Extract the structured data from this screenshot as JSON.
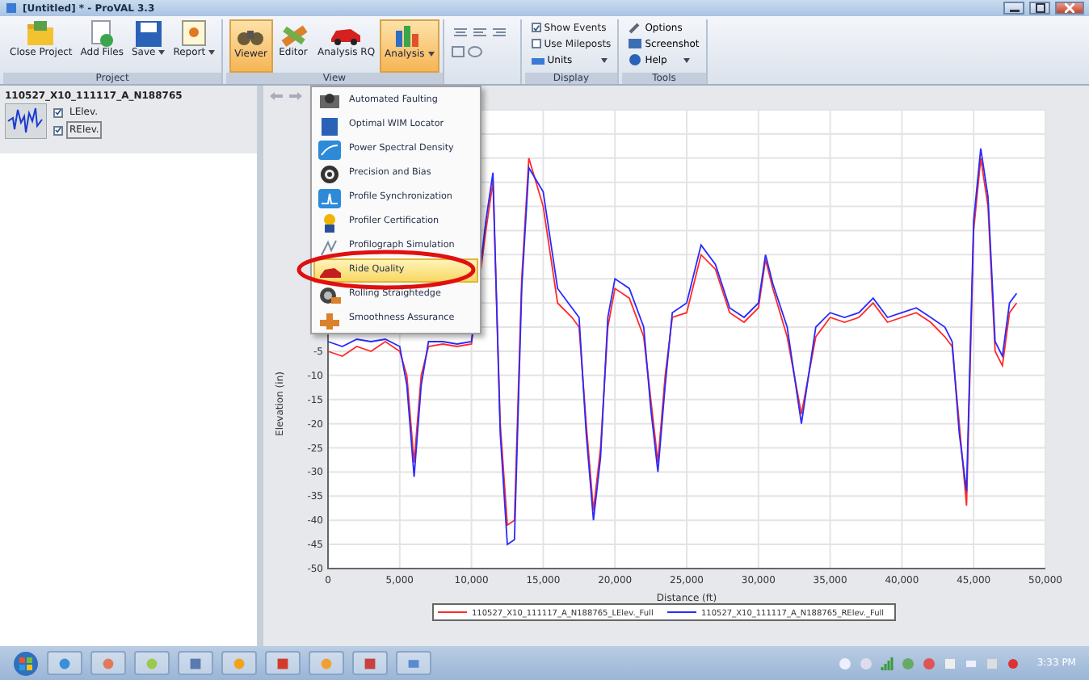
{
  "window": {
    "title": "[Untitled] * - ProVAL 3.3"
  },
  "ribbon": {
    "groups": [
      {
        "label": "Project",
        "buttons": [
          {
            "label": "Close Project",
            "dropdown": false,
            "selected": false
          },
          {
            "label": "Add Files",
            "dropdown": false,
            "selected": false
          },
          {
            "label": "Save",
            "dropdown": true,
            "selected": false
          },
          {
            "label": "Report",
            "dropdown": true,
            "selected": false
          }
        ]
      },
      {
        "label": "View",
        "buttons": [
          {
            "label": "Viewer",
            "dropdown": false,
            "selected": true
          },
          {
            "label": "Editor",
            "dropdown": false,
            "selected": false
          },
          {
            "label": "Analysis RQ",
            "dropdown": false,
            "selected": false
          },
          {
            "label": "Analysis",
            "dropdown": true,
            "selected": true
          }
        ]
      }
    ],
    "display": {
      "label": "Display",
      "items": [
        {
          "label": "Show Events",
          "kind": "check",
          "checked": true
        },
        {
          "label": "Use Mileposts",
          "kind": "check",
          "checked": false
        },
        {
          "label": "Units",
          "kind": "dropdown"
        }
      ]
    },
    "tools": {
      "label": "Tools",
      "items": [
        {
          "label": "Options",
          "dropdown": false
        },
        {
          "label": "Screenshot",
          "dropdown": false
        },
        {
          "label": "Help",
          "dropdown": true
        }
      ]
    }
  },
  "sidebar": {
    "file": "110527_X10_111117_A_N188765",
    "channels": [
      {
        "label": "LElev.",
        "checked": true
      },
      {
        "label": "RElev.",
        "checked": true
      }
    ]
  },
  "analysis_menu": [
    {
      "label": "Automated Faulting",
      "selected": false
    },
    {
      "label": "Optimal WIM Locator",
      "selected": false
    },
    {
      "label": "Power Spectral Density",
      "selected": false
    },
    {
      "label": "Precision and Bias",
      "selected": false
    },
    {
      "label": "Profile Synchronization",
      "selected": false
    },
    {
      "label": "Profiler Certification",
      "selected": false
    },
    {
      "label": "Profilograph Simulation",
      "selected": false
    },
    {
      "label": "Ride Quality",
      "selected": true
    },
    {
      "label": "Rolling Straightedge",
      "selected": false
    },
    {
      "label": "Smoothness Assurance",
      "selected": false
    }
  ],
  "chart": {
    "chart_data": {
      "type": "line",
      "xlabel": "Distance (ft)",
      "ylabel": "Elevation (in)",
      "xlim": [
        0,
        50000
      ],
      "ylim": [
        -50,
        45
      ],
      "grid": true,
      "legend": true,
      "xticks": [
        {
          "value": 0,
          "label": "0"
        },
        {
          "value": 5000,
          "label": "5,000"
        },
        {
          "value": 10000,
          "label": "10,000"
        },
        {
          "value": 15000,
          "label": "15,000"
        },
        {
          "value": 20000,
          "label": "20,000"
        },
        {
          "value": 25000,
          "label": "25,000"
        },
        {
          "value": 30000,
          "label": "30,000"
        },
        {
          "value": 35000,
          "label": "35,000"
        },
        {
          "value": 40000,
          "label": "40,000"
        },
        {
          "value": 45000,
          "label": "45,000"
        },
        {
          "value": 50000,
          "label": "50,000"
        }
      ],
      "yticks": [
        -5,
        -10,
        -15,
        -20,
        -25,
        -30,
        -35,
        -40,
        -45,
        -50
      ],
      "x": [
        0,
        1000,
        2000,
        3000,
        4000,
        5000,
        5500,
        6000,
        6500,
        7000,
        8000,
        9000,
        10000,
        11000,
        11500,
        12000,
        12500,
        13000,
        13500,
        14000,
        15000,
        16000,
        17000,
        17500,
        18000,
        18500,
        19000,
        19500,
        20000,
        21000,
        22000,
        22500,
        23000,
        23500,
        24000,
        25000,
        26000,
        27000,
        28000,
        29000,
        30000,
        30500,
        31000,
        32000,
        33000,
        34000,
        35000,
        36000,
        37000,
        38000,
        39000,
        40000,
        41000,
        42000,
        43000,
        43500,
        44000,
        44500,
        45000,
        45500,
        46000,
        46500,
        47000,
        47500,
        48000
      ],
      "series": [
        {
          "name": "110527_X10_111117_A_N188765_LElev._Full",
          "color": "#ff2a2a",
          "values": [
            -5,
            -6,
            -4,
            -5,
            -3,
            -5,
            -10,
            -28,
            -10,
            -4,
            -3.5,
            -4,
            -3.5,
            20,
            30,
            -20,
            -41,
            -40,
            10,
            35,
            25,
            5,
            2,
            0,
            -20,
            -38,
            -25,
            0,
            8,
            6,
            -2,
            -15,
            -28,
            -10,
            2,
            3,
            15,
            12,
            3,
            1,
            4,
            14,
            8,
            -2,
            -18,
            -2,
            2,
            1,
            2,
            5,
            1,
            2,
            3,
            1,
            -2,
            -4,
            -20,
            -37,
            20,
            35,
            25,
            -5,
            -8,
            3,
            5
          ]
        },
        {
          "name": "110527_X10_111117_A_N188765_RElev._Full",
          "color": "#2a2aff",
          "values": [
            -3,
            -4,
            -2.5,
            -3,
            -2.5,
            -4,
            -12,
            -31,
            -12,
            -3,
            -3,
            -3.5,
            -3,
            22,
            32,
            -22,
            -45,
            -44,
            8,
            33,
            28,
            8,
            4,
            2,
            -22,
            -40,
            -27,
            2,
            10,
            8,
            0,
            -17,
            -30,
            -12,
            3,
            5,
            17,
            13,
            4,
            2,
            5,
            15,
            9,
            0,
            -20,
            0,
            3,
            2,
            3,
            6,
            2,
            3,
            4,
            2,
            0,
            -3,
            -22,
            -34,
            22,
            37,
            27,
            -3,
            -6,
            5,
            7
          ]
        }
      ]
    }
  },
  "taskbar": {
    "clock": "3:33 PM"
  }
}
